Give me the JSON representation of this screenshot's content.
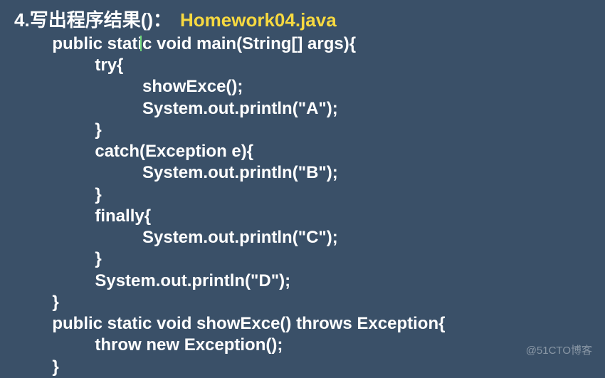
{
  "title": {
    "number": "4.",
    "text": " 写出程序结果()：  ",
    "file": "Homework04.java"
  },
  "code": {
    "l1a": "        public stati",
    "l1b": "c void main(String[] args){",
    "l2": "                 try{",
    "l3": "                           showExce();",
    "l4": "                           System.out.println(\"A\");",
    "l5": "                 }",
    "l6": "                 catch(Exception e){",
    "l7": "                           System.out.println(\"B\");",
    "l8": "                 }",
    "l9": "                 finally{",
    "l10": "                           System.out.println(\"C\");",
    "l11": "                 }",
    "l12": "                 System.out.println(\"D\");",
    "l13": "        }",
    "l14": "        public static void showExce() throws Exception{",
    "l15": "                 throw new Exception();",
    "l16": "        }"
  },
  "watermark": "@51CTO博客"
}
